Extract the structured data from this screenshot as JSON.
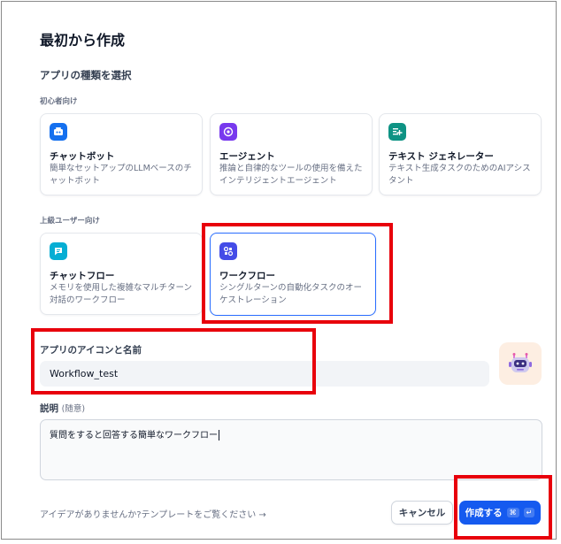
{
  "dialog": {
    "title": "最初から作成",
    "app_type_label": "アプリの種類を選択",
    "beginner_label": "初心者向け",
    "advanced_label": "上級ユーザー向け"
  },
  "beginner_cards": [
    {
      "title": "チャットボット",
      "desc": "簡単なセットアップのLLMベースのチャットボット",
      "icon": "chatbot-icon",
      "icon_color": "#1570ef"
    },
    {
      "title": "エージェント",
      "desc": "推論と自律的なツールの使用を備えたインテリジェントエージェント",
      "icon": "agent-icon",
      "icon_color": "#7839ee"
    },
    {
      "title": "テキスト ジェネレーター",
      "desc": "テキスト生成タスクのためのAIアシスタント",
      "icon": "text-generator-icon",
      "icon_color": "#0e9384"
    }
  ],
  "advanced_cards": [
    {
      "title": "チャットフロー",
      "desc": "メモリを使用した複雑なマルチターン対話のワークフロー",
      "icon": "chatflow-icon",
      "icon_color": "#06aed4"
    },
    {
      "title": "ワークフロー",
      "desc": "シングルターンの自動化タスクのオーケストレーション",
      "icon": "workflow-icon",
      "icon_color": "#444ce7",
      "selected": true
    }
  ],
  "name_section": {
    "label": "アプリのアイコンと名前",
    "value": "Workflow_test",
    "avatar_icon": "robot-avatar-icon"
  },
  "description_section": {
    "label": "説明",
    "optional": "(随意)",
    "value": "質問をすると回答する簡単なワークフロー"
  },
  "footer": {
    "hint": "アイデアがありませんか?テンプレートをご覧ください →",
    "cancel": "キャンセル",
    "create": "作成する",
    "shortcut_cmd": "⌘",
    "shortcut_enter": "↵"
  },
  "colors": {
    "primary": "#155aef",
    "selected_border": "#296dff",
    "annotation_red": "#e8000b"
  }
}
